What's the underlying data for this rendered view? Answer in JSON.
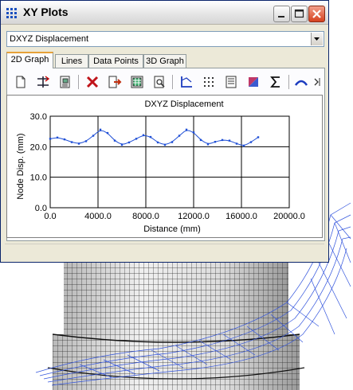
{
  "window": {
    "title": "XY Plots",
    "dropdown_value": "DXYZ Displacement",
    "tabs": [
      {
        "label": "2D Graph",
        "active": true
      },
      {
        "label": "Lines",
        "active": false
      },
      {
        "label": "Data Points",
        "active": false
      },
      {
        "label": "3D Graph",
        "active": false
      }
    ],
    "toolbar_icons": [
      "new-icon",
      "fit-icon",
      "copy-icon",
      "delete-icon",
      "export-icon",
      "print-icon",
      "print-preview-icon",
      "axes-icon",
      "grid-icon",
      "properties-icon",
      "fill-icon",
      "sum-icon",
      "curve-icon",
      "more-icon"
    ]
  },
  "colors": {
    "series": "#1f4fd6",
    "mesh": "#1a1a1a",
    "wire": "#3355dd"
  },
  "chart_data": {
    "type": "line",
    "title": "DXYZ Displacement",
    "xlabel": "Distance (mm)",
    "ylabel": "Node Disp. (mm)",
    "xlim": [
      0,
      20000
    ],
    "ylim": [
      0,
      30
    ],
    "x_ticks": [
      "0.0",
      "4000.0",
      "8000.0",
      "12000.0",
      "16000.0",
      "20000.0"
    ],
    "y_ticks": [
      "0.0",
      "10.0",
      "20.0",
      "30.0"
    ],
    "grid": true,
    "series": [
      {
        "x": [
          0,
          600,
          1200,
          1800,
          2400,
          3000,
          3600,
          4200,
          4800,
          5400,
          6000,
          6600,
          7200,
          7800,
          8400,
          9000,
          9600,
          10200,
          10800,
          11400,
          12000,
          12600,
          13200,
          13800,
          14400,
          15000,
          15600,
          16200,
          16800,
          17400
        ],
        "values": [
          22.6,
          23.0,
          22.4,
          21.5,
          21.0,
          21.8,
          23.6,
          25.6,
          24.5,
          22.0,
          20.6,
          21.4,
          22.6,
          23.8,
          23.2,
          21.4,
          20.6,
          21.5,
          23.6,
          25.6,
          24.7,
          22.2,
          20.8,
          21.6,
          22.2,
          22.0,
          21.0,
          20.3,
          21.5,
          23.1
        ]
      }
    ]
  }
}
